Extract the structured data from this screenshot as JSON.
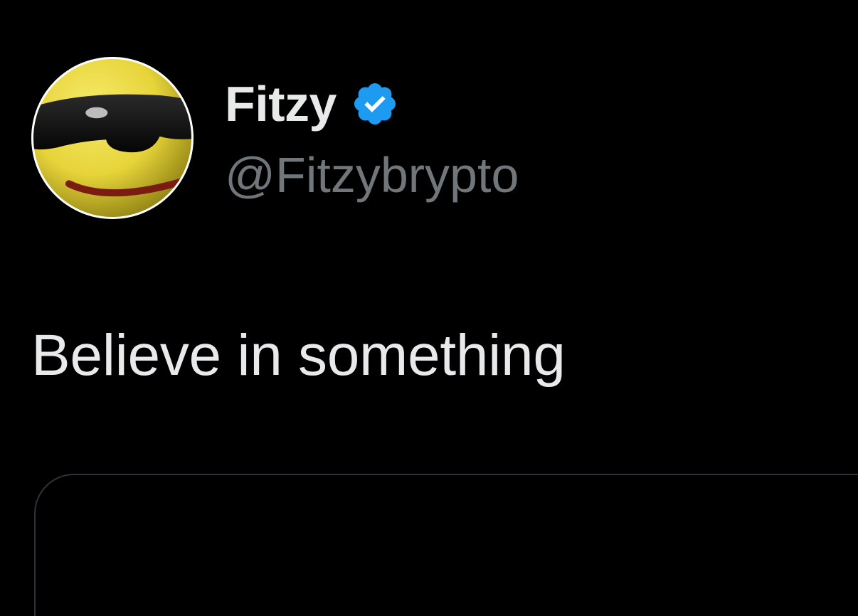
{
  "tweet": {
    "author": {
      "display_name": "Fitzy",
      "handle": "@Fitzybrypto",
      "verified": true,
      "avatar_icon": "cool-sunglasses-emoji",
      "verified_icon": "verified-badge-icon"
    },
    "text": "Believe in something"
  },
  "colors": {
    "background": "#000000",
    "primary_text": "#e7e9ea",
    "secondary_text": "#71767b",
    "verified_blue": "#1d9bf0",
    "border": "#2f3336"
  }
}
